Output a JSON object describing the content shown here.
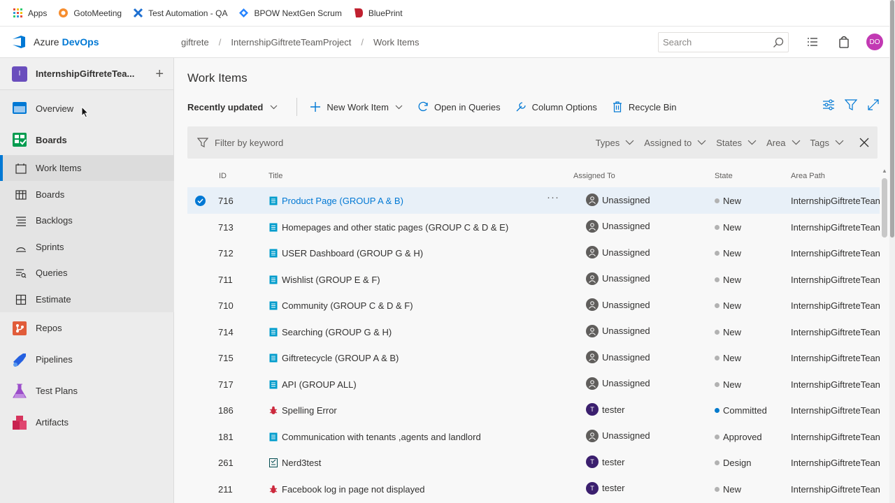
{
  "bookmarks": [
    {
      "label": "Apps",
      "icon": "apps-grid-icon"
    },
    {
      "label": "GotoMeeting",
      "icon": "gotomeeting-icon"
    },
    {
      "label": "Test Automation - QA",
      "icon": "test-automation-icon"
    },
    {
      "label": "BPOW NextGen Scrum",
      "icon": "bpow-icon"
    },
    {
      "label": "BluePrint",
      "icon": "blueprint-icon"
    }
  ],
  "header": {
    "brand_plain": "Azure",
    "brand_bold": "DevOps",
    "breadcrumbs": [
      "giftrete",
      "InternshipGiftreteTeamProject",
      "Work Items"
    ],
    "search_placeholder": "Search",
    "avatar_initials": "DO",
    "avatar_color": "#c239b3"
  },
  "sidebar": {
    "project_initial": "I",
    "project_name": "InternshipGiftreteTea...",
    "items": [
      {
        "label": "Overview",
        "icon": "overview-icon"
      },
      {
        "label": "Boards",
        "icon": "boards-hub-icon"
      },
      {
        "label": "Work Items",
        "icon": "work-items-icon"
      },
      {
        "label": "Boards",
        "icon": "boards-icon"
      },
      {
        "label": "Backlogs",
        "icon": "backlogs-icon"
      },
      {
        "label": "Sprints",
        "icon": "sprints-icon"
      },
      {
        "label": "Queries",
        "icon": "queries-icon"
      },
      {
        "label": "Estimate",
        "icon": "estimate-icon"
      },
      {
        "label": "Repos",
        "icon": "repos-icon"
      },
      {
        "label": "Pipelines",
        "icon": "pipelines-icon"
      },
      {
        "label": "Test Plans",
        "icon": "test-plans-icon"
      },
      {
        "label": "Artifacts",
        "icon": "artifacts-icon"
      }
    ]
  },
  "main": {
    "title": "Work Items",
    "toolbar": {
      "view": "Recently updated",
      "new_item": "New Work Item",
      "open_queries": "Open in Queries",
      "column_options": "Column Options",
      "recycle_bin": "Recycle Bin"
    },
    "filter": {
      "placeholder": "Filter by keyword",
      "chips": [
        "Types",
        "Assigned to",
        "States",
        "Area",
        "Tags"
      ]
    },
    "columns": {
      "id": "ID",
      "title": "Title",
      "assigned": "Assigned To",
      "state": "State",
      "area": "Area Path"
    },
    "rows": [
      {
        "id": "716",
        "title": "Product Page (GROUP A & B)",
        "type": "user-story",
        "assigned": "Unassigned",
        "state": "New",
        "area": "InternshipGiftreteTean"
      },
      {
        "id": "713",
        "title": "Homepages and other static pages (GROUP C & D & E)",
        "type": "user-story",
        "assigned": "Unassigned",
        "state": "New",
        "area": "InternshipGiftreteTean"
      },
      {
        "id": "712",
        "title": "USER Dashboard (GROUP G & H)",
        "type": "user-story",
        "assigned": "Unassigned",
        "state": "New",
        "area": "InternshipGiftreteTean"
      },
      {
        "id": "711",
        "title": "Wishlist (GROUP E & F)",
        "type": "user-story",
        "assigned": "Unassigned",
        "state": "New",
        "area": "InternshipGiftreteTean"
      },
      {
        "id": "710",
        "title": "Community (GROUP C & D & F)",
        "type": "user-story",
        "assigned": "Unassigned",
        "state": "New",
        "area": "InternshipGiftreteTean"
      },
      {
        "id": "714",
        "title": "Searching (GROUP G & H)",
        "type": "user-story",
        "assigned": "Unassigned",
        "state": "New",
        "area": "InternshipGiftreteTean"
      },
      {
        "id": "715",
        "title": "Giftretecycle (GROUP A & B)",
        "type": "user-story",
        "assigned": "Unassigned",
        "state": "New",
        "area": "InternshipGiftreteTean"
      },
      {
        "id": "717",
        "title": "API (GROUP ALL)",
        "type": "user-story",
        "assigned": "Unassigned",
        "state": "New",
        "area": "InternshipGiftreteTean"
      },
      {
        "id": "186",
        "title": "Spelling Error",
        "type": "bug",
        "assigned": "tester",
        "state": "Committed",
        "area": "InternshipGiftreteTean"
      },
      {
        "id": "181",
        "title": "Communication with tenants ,agents and landlord",
        "type": "user-story",
        "assigned": "Unassigned",
        "state": "Approved",
        "area": "InternshipGiftreteTean"
      },
      {
        "id": "261",
        "title": "Nerd3test",
        "type": "test-case",
        "assigned": "tester",
        "state": "Design",
        "area": "InternshipGiftreteTean"
      },
      {
        "id": "211",
        "title": "Facebook log in page not displayed",
        "type": "bug",
        "assigned": "tester",
        "state": "New",
        "area": "InternshipGiftreteTean"
      }
    ],
    "tester_initial": "T",
    "state_colors": {
      "New": "#b2b2b2",
      "Committed": "#007acc",
      "Approved": "#b2b2b2",
      "Design": "#b2b2b2"
    }
  }
}
